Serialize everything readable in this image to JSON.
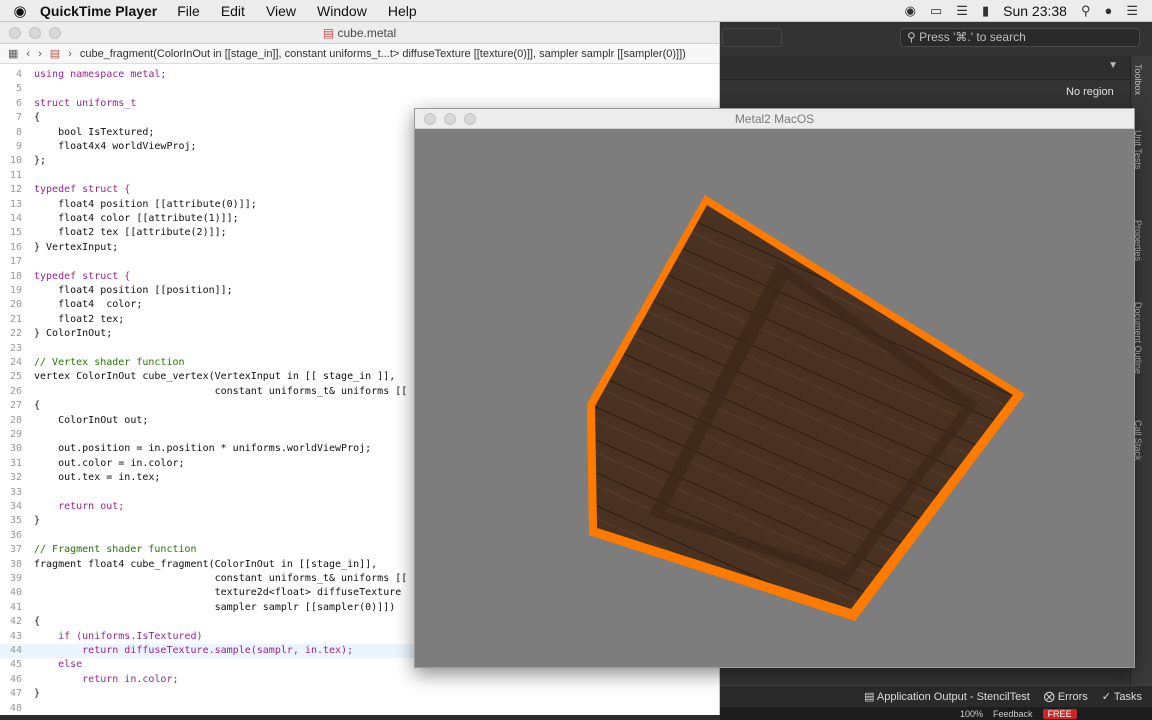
{
  "menubar": {
    "apple": "",
    "app_name": "QuickTime Player",
    "items": [
      "File",
      "Edit",
      "View",
      "Window",
      "Help"
    ],
    "clock": "Sun 23:38"
  },
  "xcode": {
    "search_placeholder": "Press '⌘.' to search",
    "no_region": "No region",
    "toolbox": "Toolbox",
    "side_labels": [
      "Unit Tests",
      "Properties",
      "Document Outline",
      "Call Stack"
    ],
    "status_items": [
      "Application Output - StencilTest",
      "Errors",
      "Tasks"
    ],
    "dock": {
      "zoom": "100%",
      "feedback": "Feedback",
      "badge": "FREE"
    }
  },
  "editor": {
    "title": "cube.metal",
    "breadcrumb": "cube_fragment(ColorInOut in [[stage_in]], constant uniforms_t...t> diffuseTexture [[texture(0)]], sampler samplr [[sampler(0)]])",
    "lines": [
      {
        "n": "4",
        "t": "using namespace metal;",
        "k": "kw"
      },
      {
        "n": "5",
        "t": ""
      },
      {
        "n": "6",
        "t": "struct uniforms_t",
        "k": "kw"
      },
      {
        "n": "7",
        "t": "{"
      },
      {
        "n": "8",
        "t": "    bool IsTextured;"
      },
      {
        "n": "9",
        "t": "    float4x4 worldViewProj;"
      },
      {
        "n": "10",
        "t": "};"
      },
      {
        "n": "11",
        "t": ""
      },
      {
        "n": "12",
        "t": "typedef struct {",
        "k": "kw"
      },
      {
        "n": "13",
        "t": "    float4 position [[attribute(0)]];"
      },
      {
        "n": "14",
        "t": "    float4 color [[attribute(1)]];"
      },
      {
        "n": "15",
        "t": "    float2 tex [[attribute(2)]];"
      },
      {
        "n": "16",
        "t": "} VertexInput;"
      },
      {
        "n": "17",
        "t": ""
      },
      {
        "n": "18",
        "t": "typedef struct {",
        "k": "kw"
      },
      {
        "n": "19",
        "t": "    float4 position [[position]];"
      },
      {
        "n": "20",
        "t": "    float4  color;"
      },
      {
        "n": "21",
        "t": "    float2 tex;"
      },
      {
        "n": "22",
        "t": "} ColorInOut;"
      },
      {
        "n": "23",
        "t": ""
      },
      {
        "n": "24",
        "t": "// Vertex shader function",
        "k": "cm"
      },
      {
        "n": "25",
        "t": "vertex ColorInOut cube_vertex(VertexInput in [[ stage_in ]],"
      },
      {
        "n": "26",
        "t": "                              constant uniforms_t& uniforms [["
      },
      {
        "n": "27",
        "t": "{"
      },
      {
        "n": "28",
        "t": "    ColorInOut out;"
      },
      {
        "n": "29",
        "t": ""
      },
      {
        "n": "30",
        "t": "    out.position = in.position * uniforms.worldViewProj;"
      },
      {
        "n": "31",
        "t": "    out.color = in.color;"
      },
      {
        "n": "32",
        "t": "    out.tex = in.tex;"
      },
      {
        "n": "33",
        "t": ""
      },
      {
        "n": "34",
        "t": "    return out;",
        "k": "kw"
      },
      {
        "n": "35",
        "t": "}"
      },
      {
        "n": "36",
        "t": ""
      },
      {
        "n": "37",
        "t": "// Fragment shader function",
        "k": "cm"
      },
      {
        "n": "38",
        "t": "fragment float4 cube_fragment(ColorInOut in [[stage_in]],"
      },
      {
        "n": "39",
        "t": "                              constant uniforms_t& uniforms [["
      },
      {
        "n": "40",
        "t": "                              texture2d<float> diffuseTexture"
      },
      {
        "n": "41",
        "t": "                              sampler samplr [[sampler(0)]])"
      },
      {
        "n": "42",
        "t": "{"
      },
      {
        "n": "43",
        "t": "    if (uniforms.IsTextured)",
        "k": "kw"
      },
      {
        "n": "44",
        "t": "        return diffuseTexture.sample(samplr, in.tex);",
        "k": "kw",
        "hl": true
      },
      {
        "n": "45",
        "t": "    else",
        "k": "kw"
      },
      {
        "n": "46",
        "t": "        return in.color;",
        "k": "kw"
      },
      {
        "n": "47",
        "t": "}"
      },
      {
        "n": "48",
        "t": ""
      }
    ]
  },
  "metal_window": {
    "title": "Metal2 MacOS",
    "background": "#7d7d7d",
    "outline_color": "#ff7b00",
    "wood_color": "#4a3222"
  }
}
